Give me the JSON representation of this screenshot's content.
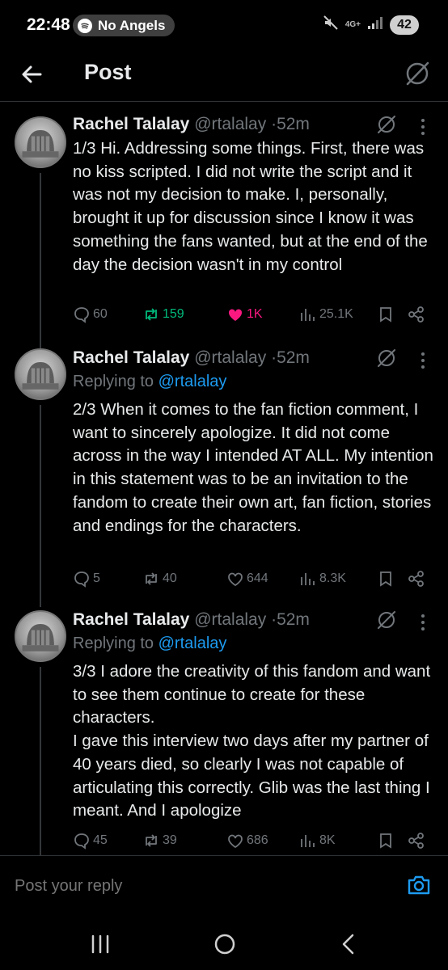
{
  "status_bar": {
    "time": "22:48",
    "now_playing": "No Angels",
    "network": "4G+",
    "battery": "42"
  },
  "header": {
    "title": "Post",
    "back_icon": "arrow-left-icon",
    "grok_icon": "grok-icon"
  },
  "posts": [
    {
      "name": "Rachel Talalay",
      "handle": "@rtalalay",
      "time": "52m",
      "replying_to": null,
      "text": "1/3 Hi. Addressing some things. First, there was no kiss scripted. I did not write the script and it was not my decision to make. I, personally, brought it up for discussion since I know it was something the fans wanted, but at the end of the day the decision wasn't in my control",
      "replies": "60",
      "reposts": "159",
      "likes": "1K",
      "views": "25.1K",
      "reposted": true,
      "liked": true
    },
    {
      "name": "Rachel Talalay",
      "handle": "@rtalalay",
      "time": "52m",
      "replying_label": "Replying to ",
      "replying_to": "@rtalalay",
      "text": "2/3 When it comes to the fan fiction comment, I want to sincerely apologize. It did not come across in the way I intended AT ALL. My intention in this statement was to be an invitation to the fandom to create their own art, fan fiction, stories and endings for the characters.",
      "replies": "5",
      "reposts": "40",
      "likes": "644",
      "views": "8.3K",
      "reposted": false,
      "liked": false
    },
    {
      "name": "Rachel Talalay",
      "handle": "@rtalalay",
      "time": "52m",
      "replying_label": "Replying to ",
      "replying_to": "@rtalalay",
      "text": "3/3 I adore the creativity of this fandom and want to see them continue to create for these characters.\nI gave this interview two days after my partner of 40 years died, so clearly I was not capable of articulating this correctly. Glib was the last thing I meant. And I apologize",
      "replies": "45",
      "reposts": "39",
      "likes": "686",
      "views": "8K",
      "reposted": false,
      "liked": false
    }
  ],
  "reply_bar": {
    "placeholder": "Post your reply"
  },
  "colors": {
    "accent": "#1d9bf0",
    "repost_active": "#00ba7c",
    "like_active": "#f91880",
    "muted": "#71767b"
  }
}
